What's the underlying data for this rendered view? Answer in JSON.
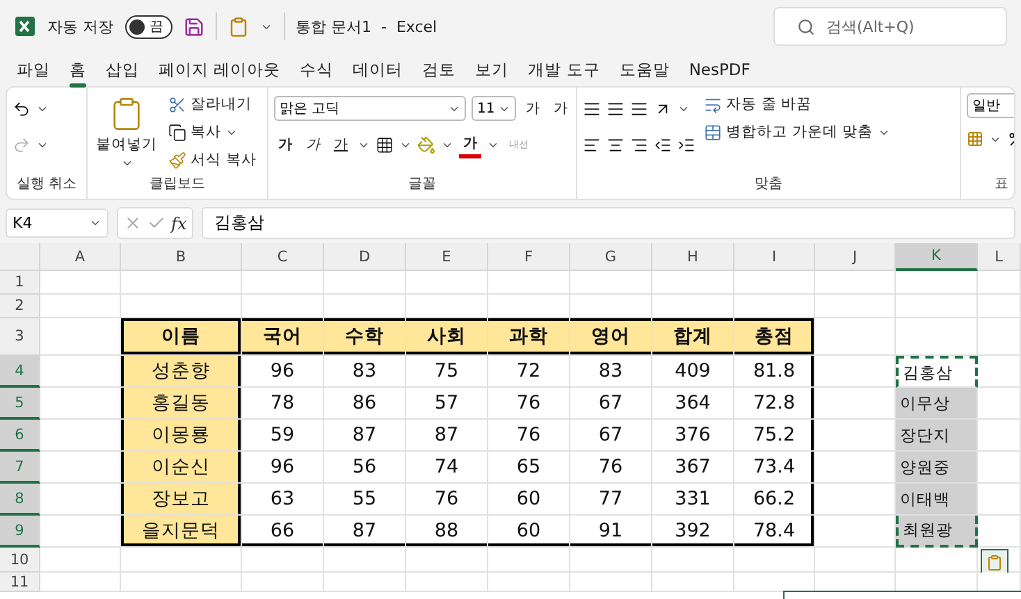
{
  "title_bar": {
    "autosave_label": "자동 저장",
    "autosave": {
      "label": "끔",
      "on": false
    },
    "document_title": "통합 문서1  -  Excel",
    "search": {
      "placeholder": "검색(Alt+Q)"
    }
  },
  "menu_tabs": [
    {
      "label": "파일",
      "selected": false
    },
    {
      "label": "홈",
      "selected": true
    },
    {
      "label": "삽입",
      "selected": false
    },
    {
      "label": "페이지 레이아웃",
      "selected": false
    },
    {
      "label": "수식",
      "selected": false
    },
    {
      "label": "데이터",
      "selected": false
    },
    {
      "label": "검토",
      "selected": false
    },
    {
      "label": "보기",
      "selected": false
    },
    {
      "label": "개발 도구",
      "selected": false
    },
    {
      "label": "도움말",
      "selected": false
    },
    {
      "label": "NesPDF",
      "selected": false
    }
  ],
  "ribbon": {
    "undo": {
      "label": "실행 취소"
    },
    "clipboard": {
      "paste": "붙여넣기",
      "cut": "잘라내기",
      "copy": "복사",
      "format_painter": "서식 복사",
      "label": "클립보드"
    },
    "font": {
      "name": "맑은 고딕",
      "size": "11",
      "grow": "가",
      "shrink": "가",
      "style_buttons": [
        {
          "kind": "bold",
          "label": "가"
        },
        {
          "kind": "italic",
          "label": "가"
        },
        {
          "kind": "underline",
          "label": "가"
        }
      ],
      "font_color": "가",
      "phonetic": "내선",
      "label": "글꼴"
    },
    "alignment": {
      "wrap_text": "자동 줄 바꿈",
      "merge_center": "병합하고 가운데 맞춤",
      "label": "맞춤"
    },
    "number": {
      "format": "일반",
      "label": "표"
    }
  },
  "formula_bar": {
    "cell_ref": "K4",
    "function_label": "fx",
    "value": "김홍삼"
  },
  "sheet": {
    "columns": [
      {
        "label": "A",
        "selected": false
      },
      {
        "label": "B",
        "selected": false
      },
      {
        "label": "C",
        "selected": false
      },
      {
        "label": "D",
        "selected": false
      },
      {
        "label": "E",
        "selected": false
      },
      {
        "label": "F",
        "selected": false
      },
      {
        "label": "G",
        "selected": false
      },
      {
        "label": "H",
        "selected": false
      },
      {
        "label": "I",
        "selected": false
      },
      {
        "label": "J",
        "selected": false
      },
      {
        "label": "K",
        "selected": true
      },
      {
        "label": "L",
        "selected": false
      }
    ],
    "rows": [
      "1",
      "2",
      "3",
      "4",
      "5",
      "6",
      "7",
      "8",
      "9",
      "10",
      "11"
    ],
    "table": {
      "header": [
        "이름",
        "국어",
        "수학",
        "사회",
        "과학",
        "영어",
        "합계",
        "총점"
      ],
      "rows": [
        {
          "name": "성춘향",
          "values": [
            "96",
            "83",
            "75",
            "72",
            "83",
            "409",
            "81.8"
          ]
        },
        {
          "name": "홍길동",
          "values": [
            "78",
            "86",
            "57",
            "76",
            "67",
            "364",
            "72.8"
          ]
        },
        {
          "name": "이몽룡",
          "values": [
            "59",
            "87",
            "87",
            "76",
            "67",
            "376",
            "75.2"
          ]
        },
        {
          "name": "이순신",
          "values": [
            "96",
            "56",
            "74",
            "65",
            "76",
            "367",
            "73.4"
          ]
        },
        {
          "name": "장보고",
          "values": [
            "63",
            "55",
            "76",
            "60",
            "77",
            "331",
            "66.2"
          ]
        },
        {
          "name": "을지문덕",
          "values": [
            "66",
            "87",
            "88",
            "60",
            "91",
            "392",
            "78.4"
          ]
        }
      ]
    },
    "name_list": [
      {
        "text": "김홍삼",
        "selected": true
      },
      {
        "text": "이무상",
        "selected": false
      },
      {
        "text": "장단지",
        "selected": false
      },
      {
        "text": "양원중",
        "selected": false
      },
      {
        "text": "이태백",
        "selected": false
      },
      {
        "text": "최원광",
        "selected": false
      }
    ]
  }
}
